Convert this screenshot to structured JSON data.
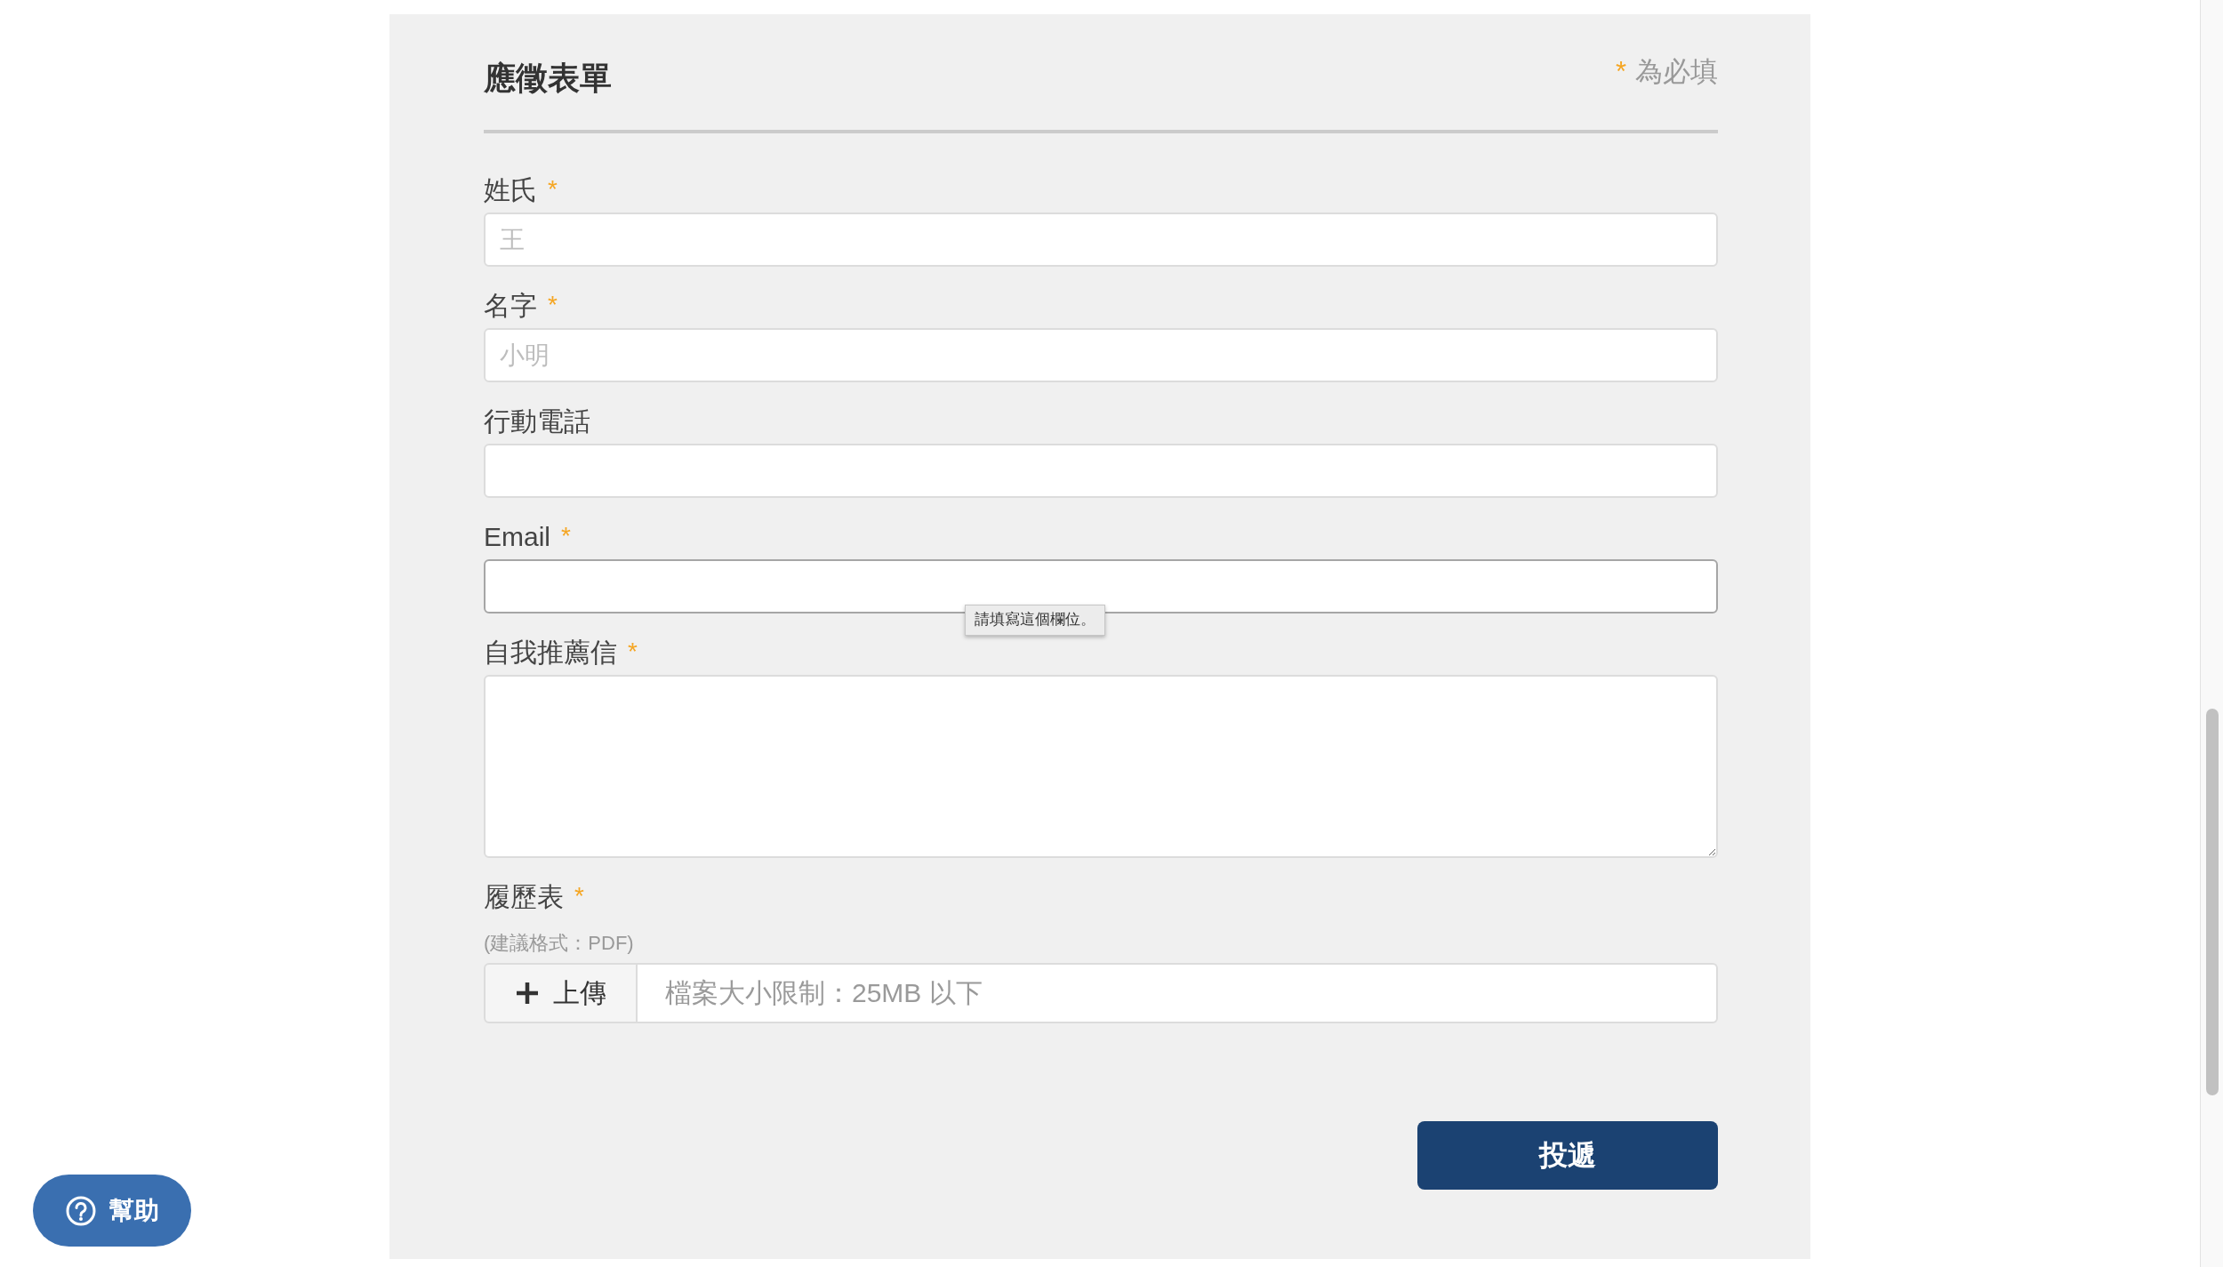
{
  "form": {
    "title": "應徵表單",
    "required_note": {
      "mark": "*",
      "text": "為必填"
    },
    "fields": [
      {
        "kind": "text",
        "label": "姓氏",
        "required_mark": "*",
        "placeholder": "王",
        "focused": false
      },
      {
        "kind": "text",
        "label": "名字",
        "required_mark": "*",
        "placeholder": "小明",
        "focused": false
      },
      {
        "kind": "text",
        "label": "行動電話",
        "focused": false
      },
      {
        "kind": "text",
        "label": "Email",
        "required_mark": "*",
        "focused": true,
        "tooltip": "請填寫這個欄位。"
      },
      {
        "kind": "textarea",
        "label": "自我推薦信",
        "required_mark": "*",
        "focused": false
      },
      {
        "kind": "file",
        "label": "履歷表",
        "required_mark": "*",
        "hint": "(建議格式：PDF)",
        "button": "上傳",
        "placeholder": "檔案大小限制：25MB 以下",
        "focused": false
      }
    ],
    "submit_button": "投遞"
  },
  "help_button": "幫助"
}
